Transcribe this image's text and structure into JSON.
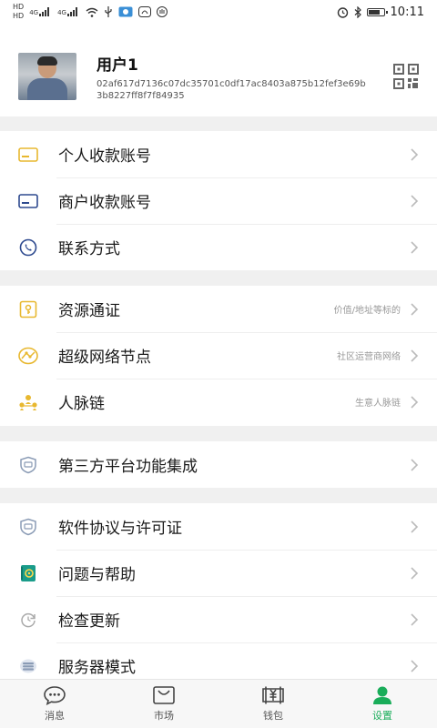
{
  "status_bar": {
    "left_mini": [
      "HD",
      "HD"
    ],
    "signal_a": "4G",
    "signal_b": "4G",
    "time": "10:11",
    "battery_level": 0.8
  },
  "profile": {
    "name": "用户1",
    "address": "02af617d7136c07dc35701c0df17ac8403a875b12fef3e69b3b8227ff8f7f84935",
    "qr_icon": "qr-code-icon"
  },
  "groups": [
    {
      "items": [
        {
          "label": "个人收款账号",
          "hint": "",
          "icon": "card-icon",
          "color": "#e8b830"
        },
        {
          "label": "商户收款账号",
          "hint": "",
          "icon": "card-icon",
          "color": "#2e4a8f"
        },
        {
          "label": "联系方式",
          "hint": "",
          "icon": "phone-icon",
          "color": "#2e4a8f"
        }
      ]
    },
    {
      "items": [
        {
          "label": "资源通证",
          "hint": "价值/地址等标的",
          "icon": "key-card-icon",
          "color": "#e8b830"
        },
        {
          "label": "超级网络节点",
          "hint": "社区运营商网络",
          "icon": "network-node-icon",
          "color": "#e8b830"
        },
        {
          "label": "人脉链",
          "hint": "生意人脉链",
          "icon": "people-chain-icon",
          "color": "#e8b830"
        }
      ]
    },
    {
      "items": [
        {
          "label": "第三方平台功能集成",
          "hint": "",
          "icon": "shield-badge-icon",
          "color": "#8a9bb5"
        }
      ]
    },
    {
      "items": [
        {
          "label": "软件协议与许可证",
          "hint": "",
          "icon": "shield-badge-icon",
          "color": "#8a9bb5"
        },
        {
          "label": "问题与帮助",
          "hint": "",
          "icon": "help-book-icon",
          "color": "#1a9c8a"
        },
        {
          "label": "检查更新",
          "hint": "",
          "icon": "refresh-icon",
          "color": "#aaaaaa"
        },
        {
          "label": "服务器模式",
          "hint": "",
          "icon": "server-icon",
          "color": "#8a9bb5"
        }
      ]
    }
  ],
  "tabs": [
    {
      "label": "消息",
      "icon": "chat-icon",
      "active": false
    },
    {
      "label": "市场",
      "icon": "market-icon",
      "active": false
    },
    {
      "label": "钱包",
      "icon": "wallet-icon",
      "active": false
    },
    {
      "label": "设置",
      "icon": "person-icon",
      "active": true
    }
  ],
  "colors": {
    "accent": "#1aad5a",
    "separator": "#f0f0f0",
    "hint": "#999999"
  }
}
